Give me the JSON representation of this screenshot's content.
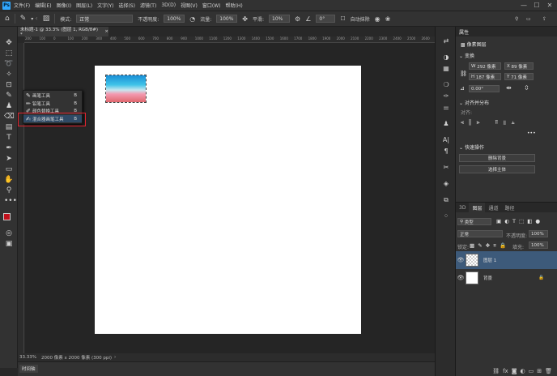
{
  "menubar": {
    "logo": "Ps",
    "items": [
      "文件(F)",
      "编辑(E)",
      "图像(I)",
      "图层(L)",
      "文字(Y)",
      "选择(S)",
      "滤镜(T)",
      "3D(D)",
      "视图(V)",
      "窗口(W)",
      "帮助(H)"
    ],
    "minimize": "—",
    "maximize": "☐",
    "close": "✕"
  },
  "options": {
    "mode_label": "模式:",
    "mode_value": "正常",
    "opacity_label": "不透明度:",
    "opacity_value": "100%",
    "flow_label": "流量:",
    "flow_value": "100%",
    "smooth_label": "平滑:",
    "smooth_value": "10%",
    "angle_value": "0°",
    "auto_erase": "自动抹除"
  },
  "document": {
    "tab_title": "未标题-1 @ 33.3% (图层 1, RGB/8#) *",
    "tab_close": "×"
  },
  "ruler": {
    "ticks": [
      "200",
      "100",
      "0",
      "100",
      "200",
      "300",
      "400",
      "500",
      "600",
      "700",
      "800",
      "900",
      "1000",
      "1100",
      "1200",
      "1300",
      "1400",
      "1500",
      "1600",
      "1700",
      "1800",
      "1900",
      "2000",
      "2100",
      "2200",
      "2300",
      "2400",
      "2500",
      "2600"
    ]
  },
  "flyout": {
    "items": [
      {
        "label": "画笔工具",
        "key": "B"
      },
      {
        "label": "铅笔工具",
        "key": "B"
      },
      {
        "label": "颜色替换工具",
        "key": "B"
      },
      {
        "label": "混合器画笔工具",
        "key": "B"
      }
    ]
  },
  "status": {
    "zoom": "33.33%",
    "info": "2000 像素 x 2000 像素 (300 ppi)"
  },
  "timeline": {
    "label": "时间轴"
  },
  "properties": {
    "title": "属性",
    "doc_label": "像素图层",
    "transform_title": "变换",
    "w_label": "W",
    "w_value": "292 像素",
    "h_label": "H",
    "h_value": "187 像素",
    "x_label": "X",
    "x_value": "89 像素",
    "y_label": "Y",
    "y_value": "71 像素",
    "angle_value": "0.00°",
    "align_title": "对齐并分布",
    "align_sub": "对齐:",
    "more": "•••",
    "quick_title": "快速操作",
    "btn_remove_bg": "删除背景",
    "btn_select_subject": "选择主体"
  },
  "layers": {
    "tabs": [
      "3D",
      "图层",
      "通道",
      "路径"
    ],
    "filter_type": "类型",
    "blend_mode": "正常",
    "opacity_label": "不透明度:",
    "opacity_value": "100%",
    "lock_label": "锁定:",
    "fill_label": "填充:",
    "fill_value": "100%",
    "rows": [
      {
        "name": "图层 1"
      },
      {
        "name": "背景"
      }
    ]
  },
  "colors": {
    "foreground": "#c0101b",
    "background": "#ffffff",
    "selection_highlight": "#e0232e"
  }
}
